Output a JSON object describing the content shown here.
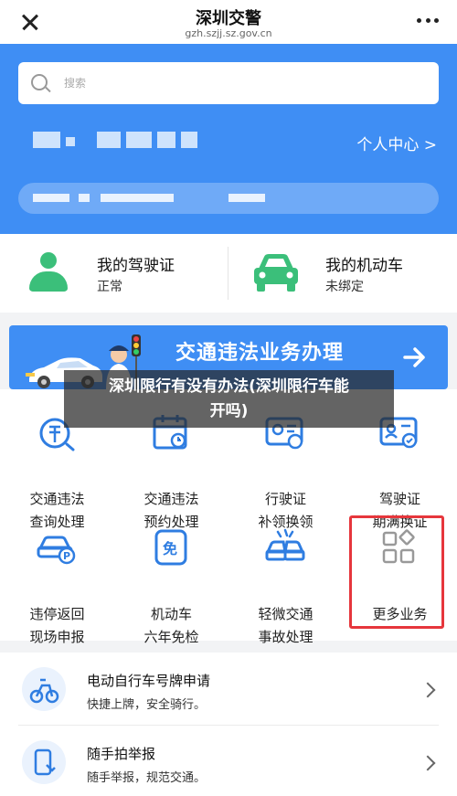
{
  "navbar": {
    "title": "深圳交警",
    "url": "gzh.szjj.sz.gov.cn"
  },
  "header": {
    "search_placeholder": "搜索",
    "profile_link": "个人中心 >"
  },
  "cards": [
    {
      "title": "我的驾驶证",
      "status": "正常",
      "icon": "person-icon"
    },
    {
      "title": "我的机动车",
      "status": "未绑定",
      "icon": "car-icon"
    }
  ],
  "banner": {
    "title": "交通违法业务办理"
  },
  "caption": {
    "line1": "深圳限行有没有办法(深圳限行车能",
    "line2": "开吗)"
  },
  "services": [
    {
      "line1": "交通违法",
      "line2": "查询处理",
      "icon": "violation-query-icon"
    },
    {
      "line1": "交通违法",
      "line2": "预约处理",
      "icon": "calendar-icon"
    },
    {
      "line1": "行驶证",
      "line2": "补领换领",
      "icon": "vehicle-license-icon"
    },
    {
      "line1": "驾驶证",
      "line2": "期满换证",
      "icon": "driver-license-icon"
    },
    {
      "line1": "违停返回",
      "line2": "现场申报",
      "icon": "parking-car-icon"
    },
    {
      "line1": "机动车",
      "line2": "六年免检",
      "icon": "exempt-badge-icon"
    },
    {
      "line1": "轻微交通",
      "line2": "事故处理",
      "icon": "accident-icon"
    },
    {
      "line1": "更多业务",
      "line2": "",
      "icon": "more-apps-icon"
    }
  ],
  "list": [
    {
      "title": "电动自行车号牌申请",
      "sub": "快捷上牌，安全骑行。",
      "icon": "ebike-icon"
    },
    {
      "title": "随手拍举报",
      "sub": "随手举报，规范交通。",
      "icon": "phone-report-icon"
    }
  ],
  "colors": {
    "primary_blue": "#3f8ef4",
    "green": "#3bbf7a",
    "highlight_red": "#e6363c"
  }
}
